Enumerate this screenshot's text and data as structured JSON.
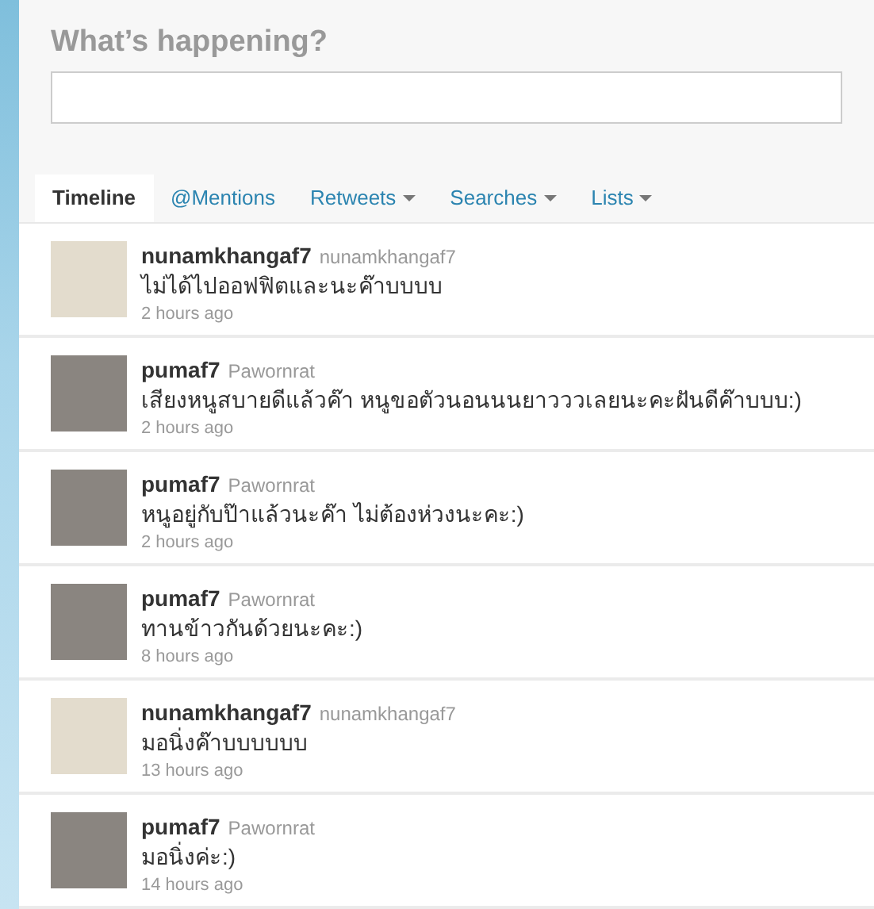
{
  "composer": {
    "heading": "What’s happening?"
  },
  "tabs": [
    {
      "label": "Timeline",
      "selected": true,
      "has_menu": false
    },
    {
      "label": "@Mentions",
      "selected": false,
      "has_menu": false
    },
    {
      "label": "Retweets",
      "selected": false,
      "has_menu": true
    },
    {
      "label": "Searches",
      "selected": false,
      "has_menu": true
    },
    {
      "label": "Lists",
      "selected": false,
      "has_menu": true
    }
  ],
  "tweets": [
    {
      "username": "nunamkhangaf7",
      "display_name": "nunamkhangaf7",
      "text": "ไม่ได้ไปออฟฟิตและนะค๊าบบบบ",
      "time": "2 hours ago"
    },
    {
      "username": "pumaf7",
      "display_name": "Pawornrat",
      "text": "เสียงหนูสบายดีแล้วค๊า หนูขอตัวนอนนนยาวววเลยนะคะฝันดีค๊าบบบ:)",
      "time": "2 hours ago"
    },
    {
      "username": "pumaf7",
      "display_name": "Pawornrat",
      "text": "หนูอยู่กับป๊าแล้วนะค๊า ไม่ต้องห่วงนะคะ:)",
      "time": "2 hours ago"
    },
    {
      "username": "pumaf7",
      "display_name": "Pawornrat",
      "text": "ทานข้าวกันด้วยนะคะ:)",
      "time": "8 hours ago"
    },
    {
      "username": "nunamkhangaf7",
      "display_name": "nunamkhangaf7",
      "text": "มอนิ่งค๊าบบบบบบ",
      "time": "13 hours ago"
    },
    {
      "username": "pumaf7",
      "display_name": "Pawornrat",
      "text": "มอนิ่งค่ะ:)",
      "time": "14 hours ago"
    }
  ]
}
